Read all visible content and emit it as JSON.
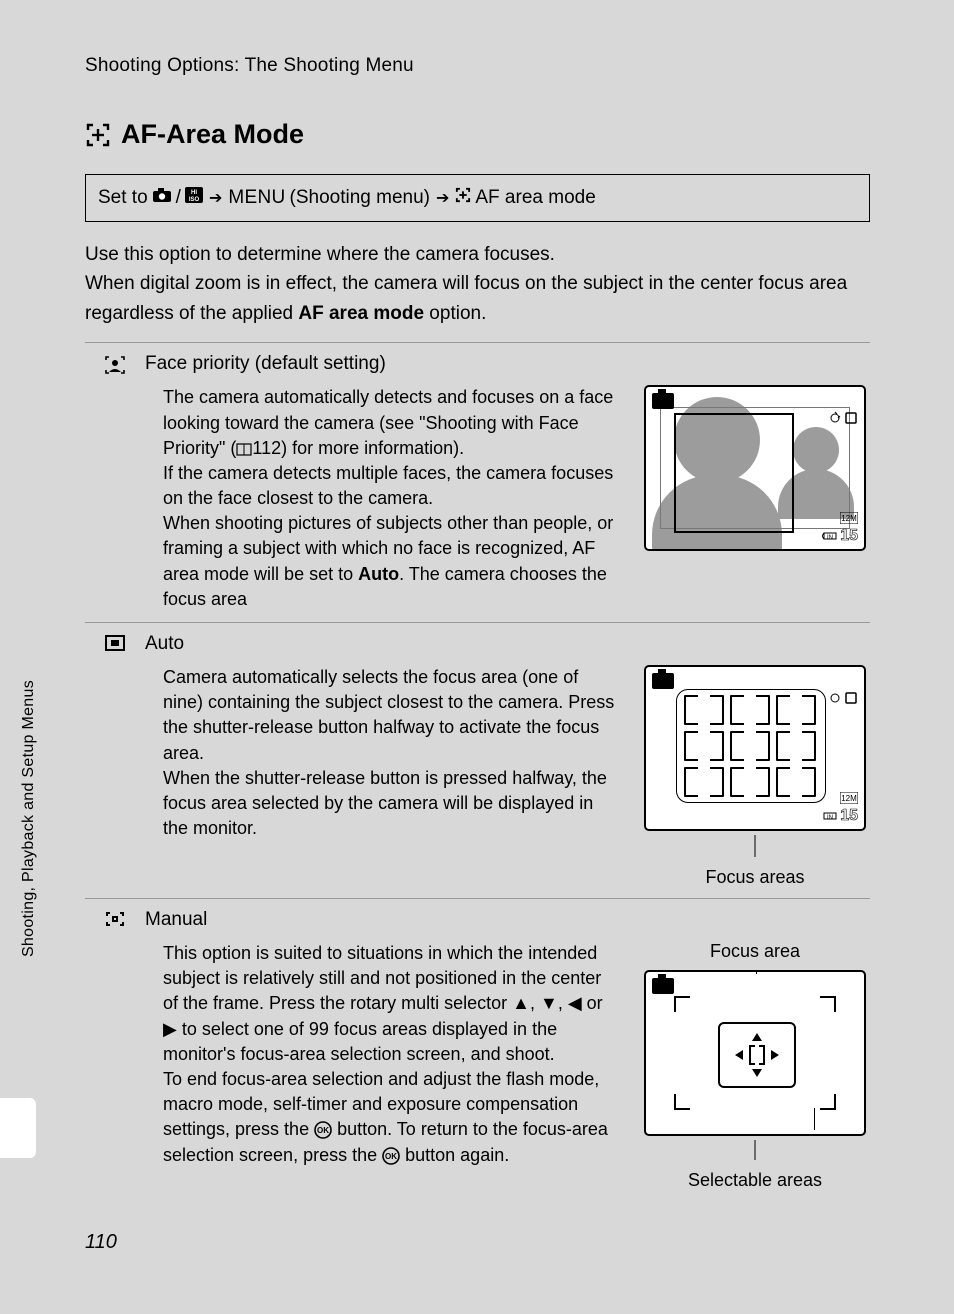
{
  "breadcrumb": "Shooting Options: The Shooting Menu",
  "section_title": "AF-Area Mode",
  "nav_prefix": "Set to",
  "nav_menu_text": "(Shooting menu)",
  "nav_suffix": "AF area mode",
  "menu_label": "MENU",
  "intro_line1": "Use this option to determine where the camera focuses.",
  "intro_line2_a": "When digital zoom is in effect, the camera will focus on the subject in the center focus area regardless of the applied ",
  "intro_line2_bold": "AF area mode",
  "intro_line2_b": " option.",
  "modes": {
    "face": {
      "title": "Face priority (default setting)",
      "t1": "The camera automatically detects and focuses on a face looking toward the camera (see \"Shooting with Face Priority\" (",
      "page_ref": "112",
      "t2": ") for more information).",
      "t3": "If the camera detects multiple faces, the camera focuses on the face closest to the camera.",
      "t4a": "When shooting pictures of subjects other than people, or framing a subject with which no face is recognized, AF area mode will be set to ",
      "t4bold": "Auto",
      "t4b": ". The camera chooses the focus area"
    },
    "auto": {
      "title": "Auto",
      "t1": "Camera automatically selects the focus area (one of nine) containing the subject closest to the camera. Press the shutter-release button halfway to activate the focus area.",
      "t2": "When the shutter-release button is pressed halfway, the focus area selected by the camera will be displayed in the monitor.",
      "caption": "Focus areas"
    },
    "manual": {
      "title": "Manual",
      "label_top": "Focus area",
      "label_bot": "Selectable areas",
      "t1": "This option is suited to situations in which the intended subject is relatively still and not positioned in the center of the frame. Press the rotary multi selector ",
      "t1b": " to select one of 99 focus areas displayed in the monitor's focus-area selection screen, and shoot.",
      "t2a": "To end focus-area selection and adjust the flash mode, macro mode, self-timer and exposure compensation settings, press the ",
      "t2b": " button. To return to the focus-area selection screen, press the ",
      "t2c": " button again."
    }
  },
  "overlay": {
    "count": "15",
    "size_badge": "12M",
    "mem_badge": "IN"
  },
  "side_tab": "Shooting, Playback and Setup Menus",
  "page_number": "110",
  "arrows_sep": ", ",
  "arrows_or": " or "
}
